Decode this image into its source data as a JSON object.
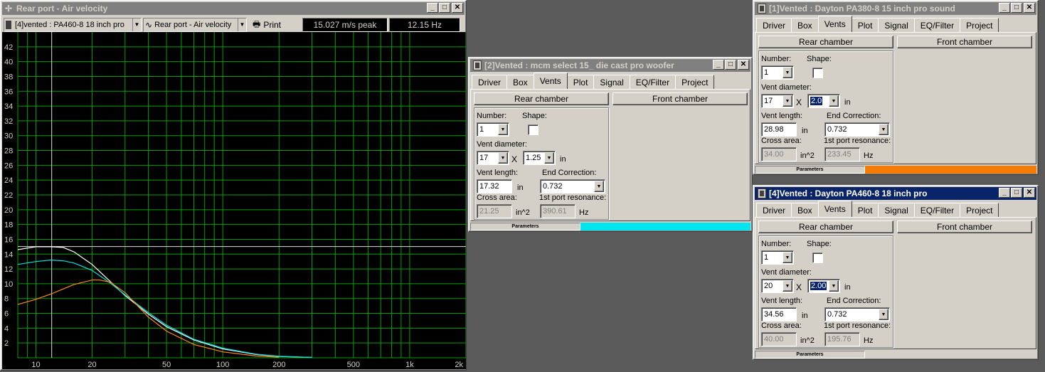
{
  "graph_window": {
    "title": "Rear port - Air velocity",
    "driver_combo": "[4]vented : PA460-8 18 inch pro",
    "plot_combo": "Rear port - Air velocity",
    "print_label": "Print",
    "peak_readout": "15.027 m/s peak",
    "freq_readout": "12.15 Hz",
    "min_label": "_",
    "max_label": "□",
    "close_label": "X"
  },
  "chart_data": {
    "type": "line",
    "x_scale": "log",
    "xlim": [
      8,
      2000
    ],
    "ylim": [
      0,
      44
    ],
    "x_ticks": [
      "10",
      "20",
      "50",
      "100",
      "200",
      "500",
      "1k",
      "2k"
    ],
    "x_tick_values": [
      10,
      20,
      50,
      100,
      200,
      500,
      1000,
      2000
    ],
    "y_ticks": [
      "2",
      "4",
      "6",
      "8",
      "10",
      "12",
      "14",
      "16",
      "18",
      "20",
      "22",
      "24",
      "26",
      "28",
      "30",
      "32",
      "34",
      "36",
      "38",
      "40",
      "42"
    ],
    "y_tick_values": [
      2,
      4,
      6,
      8,
      10,
      12,
      14,
      16,
      18,
      20,
      22,
      24,
      26,
      28,
      30,
      32,
      34,
      36,
      38,
      40,
      42
    ],
    "grid": true,
    "grid_color": "#00a000",
    "cursor_x": 12.15,
    "cursor_y": 15.027,
    "series": [
      {
        "color": "#ffffff",
        "x": [
          8,
          10,
          12,
          14,
          16,
          20,
          25,
          30,
          40,
          50,
          70,
          100,
          150,
          200,
          300
        ],
        "y": [
          14.6,
          15.0,
          15.0,
          14.9,
          14.3,
          12.6,
          10.3,
          8.4,
          5.9,
          4.2,
          2.4,
          1.2,
          0.45,
          0.18,
          0.05
        ]
      },
      {
        "color": "#00e0e0",
        "x": [
          8,
          10,
          12,
          14,
          16,
          20,
          25,
          30,
          40,
          50,
          70,
          100,
          150,
          200,
          300
        ],
        "y": [
          12.6,
          13.0,
          13.2,
          13.1,
          12.8,
          11.8,
          10.1,
          8.5,
          6.1,
          4.4,
          2.5,
          1.3,
          0.5,
          0.2,
          0.05
        ]
      },
      {
        "color": "#ff8c1a",
        "x": [
          8,
          10,
          12,
          14,
          16,
          20,
          22,
          25,
          30,
          40,
          50,
          70,
          100,
          150,
          200
        ],
        "y": [
          7.2,
          7.9,
          8.6,
          9.3,
          9.9,
          10.5,
          10.5,
          10.2,
          8.8,
          5.5,
          3.6,
          1.8,
          0.8,
          0.25,
          0.08
        ]
      }
    ]
  },
  "panel2": {
    "title": "[2]Vented : mcm select 15_ die cast pro woofer",
    "tabs": [
      "Driver",
      "Box",
      "Vents",
      "Plot",
      "Signal",
      "EQ/Filter",
      "Project"
    ],
    "rear_label": "Rear chamber",
    "front_label": "Front chamber",
    "number_label": "Number:",
    "number_value": "1",
    "shape_label": "Shape:",
    "vent_diameter_label": "Vent diameter:",
    "vent_diameter_value": "17",
    "vent_x": "X",
    "vent_diameter2_value": "1.25",
    "vent_unit": "in",
    "vent_length_label": "Vent length:",
    "vent_length_value": "17.32",
    "length_unit": "in",
    "end_corr_label": "End Correction:",
    "end_corr_value": "0.732",
    "cross_area_label": "Cross area:",
    "cross_area_value": "21.25",
    "area_unit": "in^2",
    "resonance_label": "1st port resonance:",
    "resonance_value": "390.61",
    "hz_unit": "Hz",
    "status_label": "Parameters",
    "status_color": "#00e5ee"
  },
  "panel1": {
    "title": "[1]Vented : Dayton PA380-8 15 inch pro sound",
    "tabs": [
      "Driver",
      "Box",
      "Vents",
      "Plot",
      "Signal",
      "EQ/Filter",
      "Project"
    ],
    "rear_label": "Rear chamber",
    "front_label": "Front chamber",
    "number_label": "Number:",
    "number_value": "1",
    "shape_label": "Shape:",
    "vent_diameter_label": "Vent diameter:",
    "vent_diameter_value": "17",
    "vent_x": "X",
    "vent_diameter2_value": "2.0",
    "vent_unit": "in",
    "vent_length_label": "Vent length:",
    "vent_length_value": "28.98",
    "length_unit": "in",
    "end_corr_label": "End Correction:",
    "end_corr_value": "0.732",
    "cross_area_label": "Cross area:",
    "cross_area_value": "34.00",
    "area_unit": "in^2",
    "resonance_label": "1st port resonance:",
    "resonance_value": "233.45",
    "hz_unit": "Hz",
    "status_label": "Parameters",
    "status_color": "#f57c00"
  },
  "panel4": {
    "title": "[4]Vented : Dayton PA460-8 18 inch pro",
    "tabs": [
      "Driver",
      "Box",
      "Vents",
      "Plot",
      "Signal",
      "EQ/Filter",
      "Project"
    ],
    "rear_label": "Rear chamber",
    "front_label": "Front chamber",
    "number_label": "Number:",
    "number_value": "1",
    "shape_label": "Shape:",
    "vent_diameter_label": "Vent diameter:",
    "vent_diameter_value": "20",
    "vent_x": "X",
    "vent_diameter2_value": "2.00",
    "vent_unit": "in",
    "vent_length_label": "Vent length:",
    "vent_length_value": "34.56",
    "length_unit": "in",
    "end_corr_label": "End Correction:",
    "end_corr_value": "0.732",
    "cross_area_label": "Cross area:",
    "cross_area_value": "40.00",
    "area_unit": "in^2",
    "resonance_label": "1st port resonance:",
    "resonance_value": "195.76",
    "hz_unit": "Hz",
    "status_label": "Parameters",
    "status_color": "#d4d0c8"
  }
}
